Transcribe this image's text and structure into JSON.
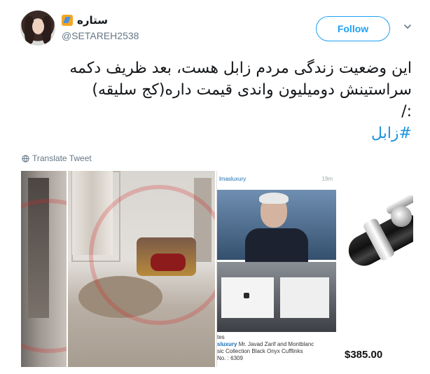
{
  "user": {
    "display_name": "ستاره",
    "handle": "@SETAREH2538",
    "emoji_icon": "rocket-emoji-icon"
  },
  "follow_label": "Follow",
  "tweet": {
    "lines": [
      "این وضعیت زندگی مردم زابل هست، بعد ظریف دکمه",
      "سراستینش دومیلیون واندی قیمت داره(کج سلیقه)",
      ":/"
    ],
    "hashtag": "#زابل"
  },
  "translate_label": "Translate Tweet",
  "media": {
    "screenshot": {
      "account": "lmasluxury",
      "time": "19m",
      "caption_user": "sluxury",
      "caption_line1": "Mr. Javad Zarif and Montblanc",
      "caption_line2": "sic Collection Black Onyx Cufflinks",
      "caption_line3": "No. : 6309",
      "caption_prefix": "tes"
    },
    "product_price": "$385.00"
  },
  "colors": {
    "accent": "#1da1f2",
    "hashtag": "#1b95e0",
    "muted": "#657786"
  }
}
